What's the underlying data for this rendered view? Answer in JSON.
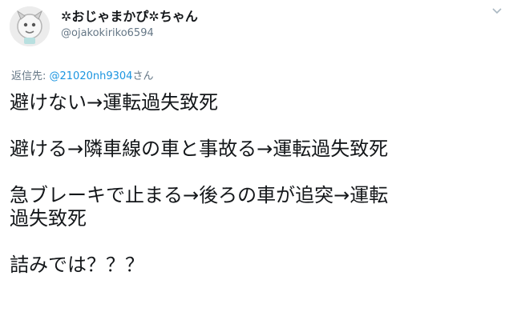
{
  "user": {
    "display_name": "✲おじゃまかぴ✲ちゃん",
    "handle": "@ojakokiriko6594",
    "avatar": "avatar-image"
  },
  "menu_icon": "chevron-down-icon",
  "reply": {
    "prefix": "返信先: ",
    "mention": "@21020nh9304",
    "suffix": "さん"
  },
  "tweet": {
    "line1": "避けない→運転過失致死",
    "line2": "避ける→隣車線の車と事故る→運転過失致死",
    "line3a": "急ブレーキで止まる→後ろの車が追突→運転",
    "line3b": "過失致死",
    "line4": "詰みでは？？？"
  },
  "colors": {
    "text": "#14171a",
    "muted": "#657786",
    "link": "#1b95e0"
  }
}
